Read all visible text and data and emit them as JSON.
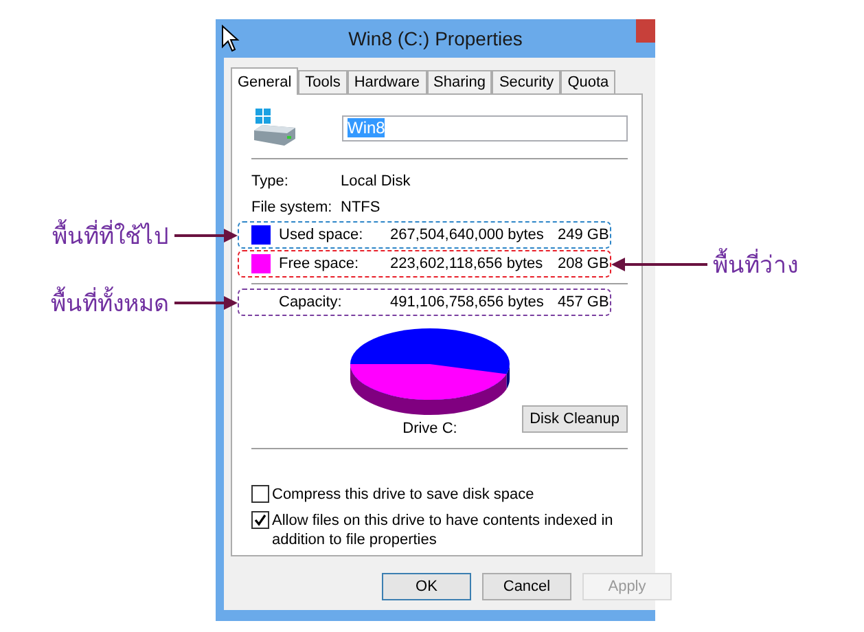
{
  "window": {
    "title": "Win8 (C:) Properties"
  },
  "tabs": [
    {
      "label": "General",
      "selected": true
    },
    {
      "label": "Tools",
      "selected": false
    },
    {
      "label": "Hardware",
      "selected": false
    },
    {
      "label": "Sharing",
      "selected": false
    },
    {
      "label": "Security",
      "selected": false
    },
    {
      "label": "Quota",
      "selected": false
    }
  ],
  "name_field": {
    "value": "Win8"
  },
  "properties": [
    {
      "label": "Type:",
      "value": "Local Disk"
    },
    {
      "label": "File system:",
      "value": "NTFS"
    }
  ],
  "space_rows": [
    {
      "kind": "used",
      "label": "Used space:",
      "bytes": "267,504,640,000 bytes",
      "size": "249 GB",
      "color": "#0000ff",
      "annotation": {
        "text": "พื้นที่ที่ใช้ไป",
        "kind": "left"
      }
    },
    {
      "kind": "free",
      "label": "Free space:",
      "bytes": "223,602,118,656 bytes",
      "size": "208 GB",
      "color": "#ff00ff",
      "annotation": {
        "text": "พื้นที่ว่าง",
        "kind": "right"
      }
    },
    {
      "kind": "total",
      "label": "Capacity:",
      "bytes": "491,106,758,656 bytes",
      "size": "457 GB",
      "annotation": {
        "text": "พื้นที่ทั้งหมด",
        "kind": "left"
      }
    }
  ],
  "drive_label": "Drive C:",
  "cleanup_button": "Disk Cleanup",
  "options": [
    {
      "label": "Compress this drive to save disk space",
      "checked": false
    },
    {
      "label": "Allow files on this drive to have contents indexed in addition to file properties",
      "checked": true
    }
  ],
  "buttons": [
    {
      "label": "OK",
      "disabled": false,
      "default": true
    },
    {
      "label": "Cancel",
      "disabled": false,
      "default": false
    },
    {
      "label": "Apply",
      "disabled": true,
      "default": false
    }
  ]
}
